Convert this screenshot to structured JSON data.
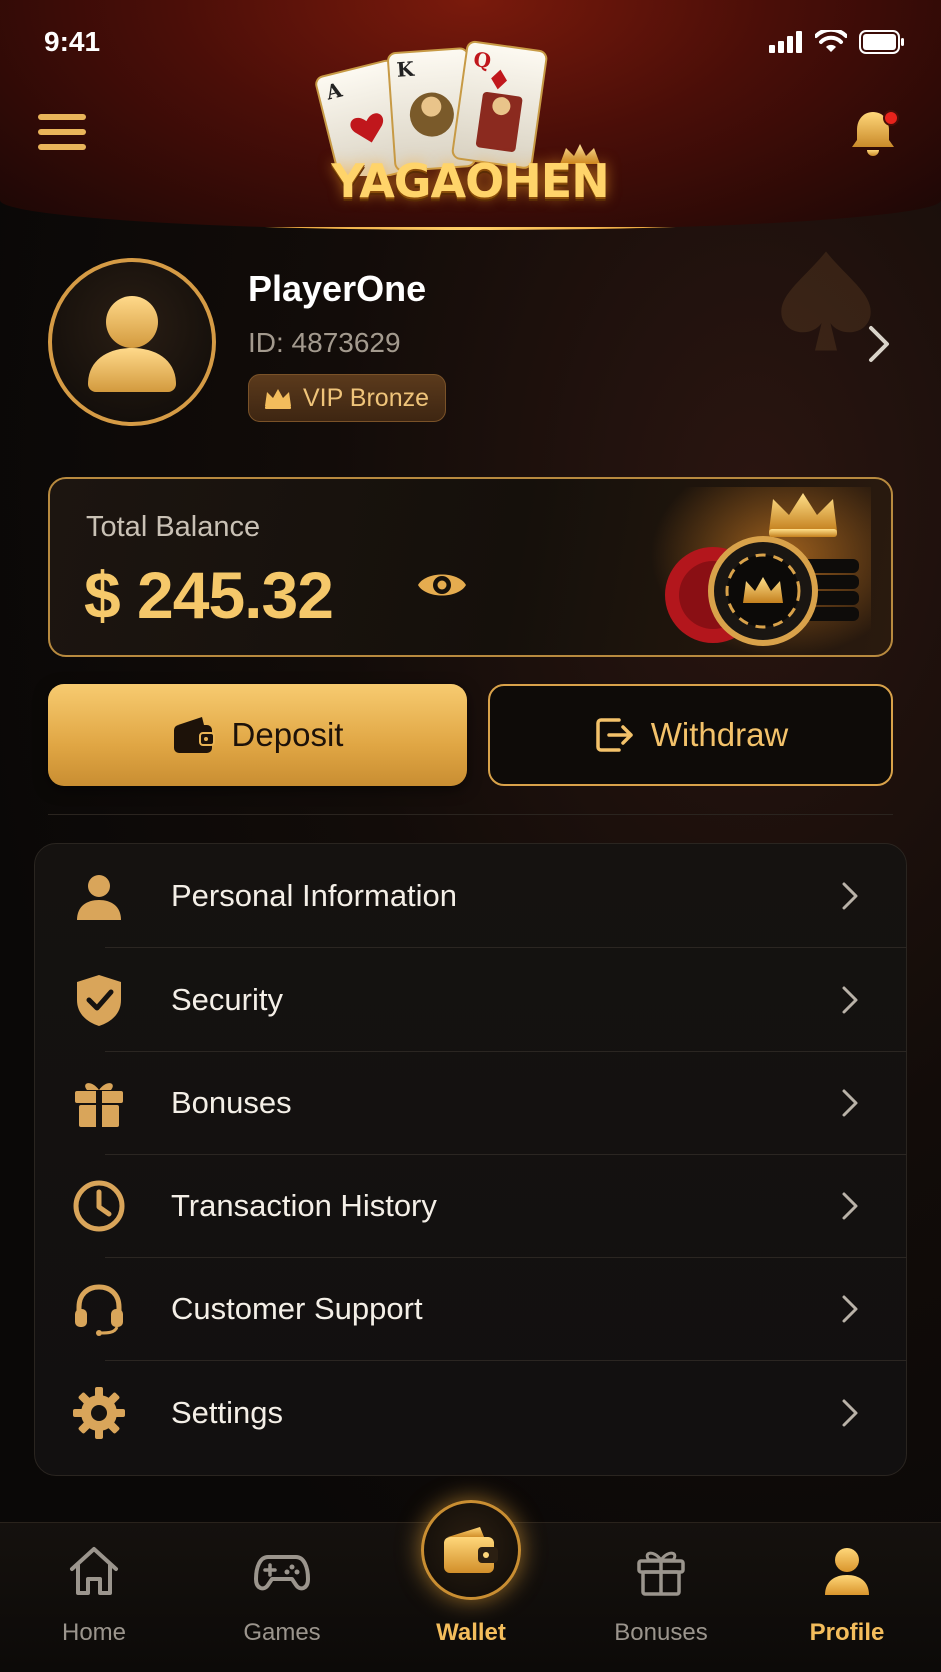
{
  "status_bar": {
    "time": "9:41"
  },
  "header": {
    "brand": "YAGAOHEN"
  },
  "profile": {
    "name": "PlayerOne",
    "id_text": "ID: 4873629",
    "vip_label": "VIP Bronze"
  },
  "balance": {
    "label": "Total Balance",
    "amount": "$ 245.32"
  },
  "actions": {
    "deposit_label": "Deposit",
    "withdraw_label": "Withdraw"
  },
  "menu": {
    "items": [
      {
        "label": "Personal Information",
        "icon": "user-icon"
      },
      {
        "label": "Security",
        "icon": "shield-icon"
      },
      {
        "label": "Bonuses",
        "icon": "gift-icon"
      },
      {
        "label": "Transaction History",
        "icon": "clock-icon"
      },
      {
        "label": "Customer Support",
        "icon": "headset-icon"
      },
      {
        "label": "Settings",
        "icon": "gear-icon"
      }
    ]
  },
  "bottom_nav": {
    "items": [
      {
        "label": "Home",
        "icon": "home-icon",
        "active": false
      },
      {
        "label": "Games",
        "icon": "gamepad-icon",
        "active": false
      },
      {
        "label": "Wallet",
        "icon": "wallet-icon",
        "active": true
      },
      {
        "label": "Bonuses",
        "icon": "gift-icon",
        "active": false
      },
      {
        "label": "Profile",
        "icon": "user-icon",
        "active": true
      }
    ]
  },
  "colors": {
    "accent_gold": "#f3bd5c",
    "header_red": "#7a1a0c",
    "notification_dot": "#e8231c",
    "background": "#0b0908"
  }
}
